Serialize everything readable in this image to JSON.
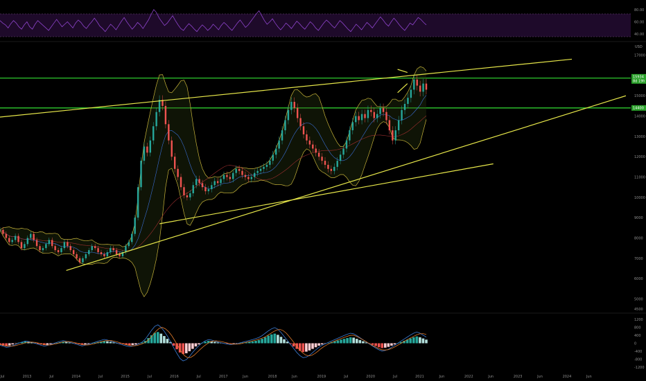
{
  "chart_data": [
    {
      "panel": "rsi",
      "type": "line",
      "y_ticks": [
        "80.00",
        "60.00",
        "40.00"
      ],
      "y_tick_values": [
        80,
        60,
        40
      ],
      "ylim": [
        30,
        90
      ],
      "band": [
        30,
        70
      ],
      "series": [
        {
          "color": "#8e44cc",
          "values": [
            62,
            58,
            55,
            50,
            57,
            62,
            58,
            52,
            48,
            55,
            60,
            52,
            48,
            56,
            62,
            58,
            54,
            50,
            46,
            52,
            58,
            64,
            58,
            52,
            56,
            60,
            55,
            50,
            58,
            63,
            59,
            53,
            49,
            55,
            60,
            66,
            60,
            53,
            49,
            44,
            50,
            56,
            52,
            47,
            54,
            61,
            67,
            60,
            54,
            48,
            53,
            59,
            55,
            49,
            56,
            63,
            72,
            80,
            75,
            66,
            60,
            54,
            58,
            64,
            70,
            62,
            55,
            49,
            46,
            52,
            57,
            53,
            48,
            44,
            50,
            55,
            51,
            46,
            50,
            56,
            52,
            47,
            54,
            59,
            55,
            50,
            46,
            52,
            58,
            63,
            57,
            51,
            55,
            61,
            67,
            73,
            78,
            70,
            62,
            56,
            60,
            65,
            58,
            52,
            47,
            52,
            58,
            54,
            49,
            55,
            61,
            57,
            52,
            48,
            54,
            60,
            56,
            50,
            46,
            52,
            58,
            63,
            59,
            54,
            50,
            56,
            62,
            58,
            53,
            48,
            44,
            50,
            56,
            52,
            47,
            53,
            59,
            55,
            50,
            56,
            62,
            68,
            63,
            57,
            53,
            60,
            66,
            61,
            55,
            50,
            46,
            52,
            58,
            55,
            61,
            67,
            64,
            59,
            55
          ]
        }
      ]
    },
    {
      "panel": "price",
      "type": "candlestick",
      "unit": "USD",
      "y_ticks": [
        "17000",
        "16000",
        "15000",
        "14000",
        "13000",
        "12000",
        "11000",
        "10000",
        "9000",
        "8000",
        "7000",
        "6000",
        "5000",
        "4500"
      ],
      "y_tick_values": [
        17000,
        16000,
        15000,
        14000,
        13000,
        12000,
        11000,
        10000,
        9000,
        8000,
        7000,
        6000,
        5000,
        4500
      ],
      "ylim": [
        4300,
        17600
      ],
      "time_range": [
        2012.45,
        2025.3
      ],
      "x_ticks": [
        "Jul",
        "2013",
        "Jul",
        "2014",
        "Jul",
        "2015",
        "Jul",
        "2016",
        "Jul",
        "2017",
        "Jun",
        "2018",
        "Jun",
        "2019",
        "Jul",
        "2020",
        "Jul",
        "2021",
        "Jun",
        "2022",
        "Jun",
        "2023",
        "Jun",
        "2024",
        "Jun"
      ],
      "x_tick_times": [
        2012.5,
        2013.0,
        2013.5,
        2014.0,
        2014.5,
        2015.0,
        2015.5,
        2016.0,
        2016.5,
        2017.0,
        2017.45,
        2018.0,
        2018.45,
        2019.0,
        2019.5,
        2020.0,
        2020.5,
        2021.0,
        2021.45,
        2022.0,
        2022.45,
        2023.0,
        2023.45,
        2024.0,
        2024.45
      ],
      "closes": [
        8400,
        8200,
        8000,
        7800,
        7900,
        8100,
        7800,
        7500,
        7700,
        8000,
        8200,
        7900,
        7600,
        7400,
        7500,
        7700,
        7900,
        7600,
        7400,
        7300,
        7500,
        7800,
        7600,
        7400,
        7200,
        7000,
        6800,
        7000,
        7200,
        7400,
        7600,
        7500,
        7300,
        7200,
        7100,
        7300,
        7500,
        7400,
        7200,
        7100,
        7300,
        7600,
        7800,
        8200,
        9000,
        10500,
        11800,
        12500,
        12200,
        12800,
        13500,
        14200,
        14800,
        14500,
        13600,
        12800,
        12000,
        11400,
        11000,
        10500,
        10100,
        10000,
        10200,
        10600,
        10900,
        10700,
        10500,
        10300,
        10400,
        10600,
        10800,
        10700,
        10900,
        11100,
        11000,
        10900,
        11200,
        11400,
        11300,
        11100,
        11000,
        10900,
        11000,
        11200,
        11300,
        11400,
        11500,
        11600,
        11800,
        12100,
        12400,
        12800,
        13300,
        13800,
        14300,
        14700,
        14400,
        13900,
        13500,
        13100,
        12800,
        12600,
        12400,
        12200,
        12000,
        11800,
        11600,
        11400,
        11300,
        11500,
        11800,
        12100,
        12400,
        12800,
        13300,
        13700,
        14000,
        13800,
        14100,
        13900,
        14300,
        14200,
        13900,
        14100,
        14400,
        14200,
        13800,
        13300,
        12800,
        13300,
        13800,
        14300,
        14600,
        14900,
        15300,
        15800,
        15500,
        15200,
        15600,
        15300
      ],
      "levels": [
        {
          "value": 15870,
          "color": "#2ecc2e"
        },
        {
          "value": 14400,
          "color": "#2ecc2e"
        }
      ],
      "trendlines": [
        {
          "from": [
            2012.45,
            13950
          ],
          "to": [
            2024.1,
            16800
          ],
          "color": "#e8e84a"
        },
        {
          "from": [
            2013.8,
            6400
          ],
          "to": [
            2025.2,
            15000
          ],
          "color": "#e8e84a"
        },
        {
          "from": [
            2015.7,
            8700
          ],
          "to": [
            2022.5,
            11650
          ],
          "color": "#e8e84a"
        },
        {
          "from": [
            2020.55,
            16300
          ],
          "to": [
            2020.75,
            16150
          ],
          "color": "#e8e84a"
        },
        {
          "from": [
            2020.55,
            15150
          ],
          "to": [
            2020.75,
            15600
          ],
          "color": "#e8e84a"
        }
      ],
      "badges": [
        {
          "text": "15934",
          "sub": "8d 19h",
          "value": 15934,
          "color": "#2aa02a"
        },
        {
          "text": "14400",
          "value": 14400,
          "color": "#2aa02a"
        }
      ]
    },
    {
      "panel": "macd",
      "type": "bar",
      "y_ticks": [
        "1200",
        "800",
        "400",
        "0",
        "-400",
        "-800",
        "-1200"
      ],
      "y_tick_values": [
        1200,
        800,
        400,
        0,
        -400,
        -800,
        -1200
      ],
      "ylim": [
        -1400,
        1400
      ],
      "histogram": [
        -80,
        -120,
        -150,
        -110,
        -60,
        -20,
        30,
        60,
        90,
        70,
        40,
        10,
        -30,
        -60,
        -90,
        -70,
        -40,
        -10,
        20,
        50,
        80,
        60,
        30,
        10,
        -20,
        -50,
        -80,
        -60,
        -30,
        0,
        30,
        60,
        90,
        120,
        100,
        70,
        40,
        10,
        -20,
        -50,
        -80,
        -110,
        -90,
        -60,
        -20,
        40,
        120,
        260,
        400,
        520,
        560,
        480,
        360,
        220,
        60,
        -120,
        -300,
        -460,
        -540,
        -500,
        -400,
        -280,
        -160,
        -60,
        20,
        80,
        120,
        100,
        70,
        40,
        20,
        0,
        -20,
        -40,
        -30,
        -10,
        10,
        30,
        50,
        70,
        90,
        120,
        160,
        220,
        300,
        380,
        440,
        480,
        420,
        320,
        200,
        80,
        -40,
        -160,
        -280,
        -380,
        -440,
        -420,
        -360,
        -280,
        -200,
        -120,
        -60,
        -20,
        20,
        60,
        100,
        140,
        180,
        220,
        260,
        300,
        280,
        220,
        160,
        100,
        40,
        -20,
        -80,
        -140,
        -200,
        -240,
        -220,
        -180,
        -120,
        -60,
        0,
        60,
        120,
        180,
        240,
        300,
        340,
        300,
        240,
        180
      ],
      "macd": [
        -100,
        -150,
        -200,
        -180,
        -120,
        -60,
        10,
        60,
        110,
        90,
        50,
        0,
        -50,
        -100,
        -140,
        -110,
        -60,
        -10,
        40,
        90,
        130,
        100,
        50,
        10,
        -40,
        -90,
        -130,
        -100,
        -50,
        0,
        50,
        100,
        150,
        190,
        160,
        110,
        60,
        10,
        -40,
        -90,
        -130,
        -170,
        -140,
        -90,
        -30,
        60,
        200,
        420,
        650,
        840,
        920,
        800,
        600,
        360,
        80,
        -220,
        -500,
        -760,
        -880,
        -820,
        -660,
        -460,
        -280,
        -120,
        20,
        120,
        180,
        160,
        110,
        60,
        20,
        -10,
        -40,
        -70,
        -50,
        -20,
        20,
        60,
        100,
        140,
        180,
        230,
        290,
        380,
        500,
        620,
        720,
        780,
        700,
        540,
        340,
        140,
        -60,
        -260,
        -460,
        -620,
        -720,
        -690,
        -600,
        -470,
        -330,
        -200,
        -100,
        -30,
        40,
        110,
        180,
        250,
        320,
        390,
        450,
        500,
        470,
        380,
        280,
        170,
        60,
        -40,
        -140,
        -240,
        -330,
        -390,
        -360,
        -300,
        -200,
        -100,
        0,
        110,
        210,
        310,
        410,
        500,
        560,
        500,
        400,
        310
      ],
      "signal": [
        -60,
        -90,
        -130,
        -150,
        -140,
        -110,
        -70,
        -30,
        20,
        50,
        60,
        40,
        10,
        -30,
        -70,
        -90,
        -80,
        -50,
        -10,
        30,
        70,
        90,
        80,
        50,
        10,
        -30,
        -70,
        -90,
        -80,
        -50,
        -10,
        40,
        80,
        120,
        140,
        130,
        100,
        60,
        10,
        -40,
        -80,
        -120,
        -130,
        -110,
        -70,
        -10,
        80,
        220,
        400,
        590,
        740,
        790,
        720,
        580,
        380,
        120,
        -160,
        -420,
        -620,
        -720,
        -700,
        -600,
        -450,
        -300,
        -160,
        -40,
        60,
        110,
        120,
        100,
        70,
        30,
        -10,
        -40,
        -50,
        -40,
        -10,
        30,
        70,
        100,
        140,
        180,
        230,
        290,
        380,
        480,
        580,
        660,
        690,
        630,
        500,
        320,
        120,
        -90,
        -290,
        -460,
        -580,
        -630,
        -600,
        -510,
        -390,
        -260,
        -150,
        -60,
        20,
        90,
        160,
        220,
        280,
        340,
        390,
        400,
        350,
        270,
        180,
        90,
        -10,
        -100,
        -180,
        -260,
        -320,
        -340,
        -320,
        -270,
        -190,
        -100,
        -10,
        90,
        180,
        260,
        340,
        420,
        470,
        480,
        440
      ]
    }
  ]
}
